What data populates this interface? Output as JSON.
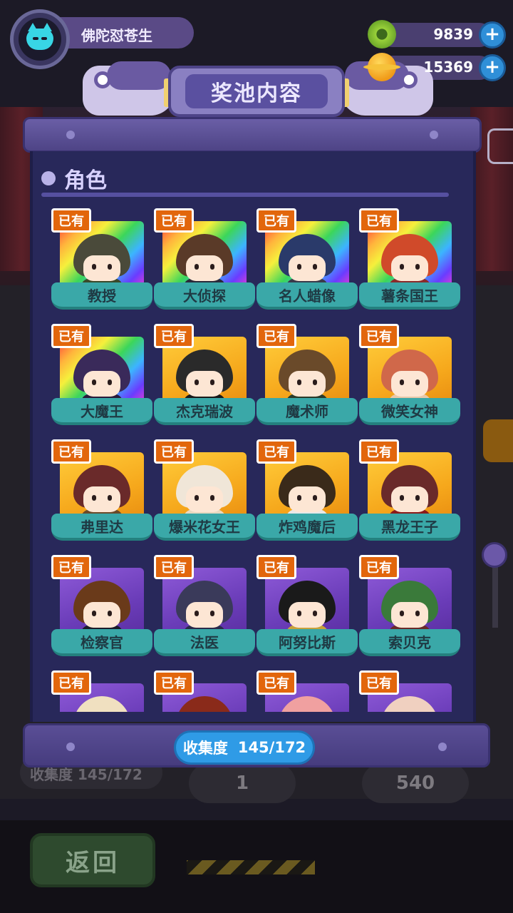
{
  "player": {
    "name": "佛陀怼苍生",
    "avatar_icon": "cat-avatar-icon"
  },
  "currencies": [
    {
      "icon": "donut-coin-icon",
      "value": "9839",
      "plus": "+"
    },
    {
      "icon": "planet-gem-icon",
      "value": "15369",
      "plus": "+"
    }
  ],
  "panel": {
    "title": "奖池内容",
    "category": "角色",
    "owned_label": "已有",
    "progress": {
      "label": "收集度",
      "value": "145/172"
    }
  },
  "characters": [
    {
      "name": "教授",
      "rarity": "rainbow",
      "hair": "#4a4a3a",
      "body": "#3a4a2a"
    },
    {
      "name": "大侦探",
      "rarity": "rainbow",
      "hair": "#5a3a28",
      "body": "#2a2a3a"
    },
    {
      "name": "名人蜡像",
      "rarity": "rainbow",
      "hair": "#2a3a6a",
      "body": "#3a3a4a"
    },
    {
      "name": "薯条国王",
      "rarity": "rainbow",
      "hair": "#d04a2a",
      "body": "#8a2a2a"
    },
    {
      "name": "大魔王",
      "rarity": "rainbow",
      "hair": "#3a2a5a",
      "body": "#2a1a3a"
    },
    {
      "name": "杰克瑞波",
      "rarity": "gold",
      "hair": "#2a2a2a",
      "body": "#1a1a1a"
    },
    {
      "name": "魔术师",
      "rarity": "gold",
      "hair": "#6a4a2a",
      "body": "#2a3a2a"
    },
    {
      "name": "微笑女神",
      "rarity": "gold",
      "hair": "#d0684a",
      "body": "#e8c8a8"
    },
    {
      "name": "弗里达",
      "rarity": "gold",
      "hair": "#6a2a2a",
      "body": "#6a4a2a"
    },
    {
      "name": "爆米花女王",
      "rarity": "gold",
      "hair": "#f0e6d8",
      "body": "#e8d8c0"
    },
    {
      "name": "炸鸡魔后",
      "rarity": "gold",
      "hair": "#3a2a1a",
      "body": "#e8e8e8"
    },
    {
      "name": "黑龙王子",
      "rarity": "gold",
      "hair": "#6a2a2a",
      "body": "#8a1a1a"
    },
    {
      "name": "检察官",
      "rarity": "purple",
      "hair": "#6a3a1a",
      "body": "#1a1a2a"
    },
    {
      "name": "法医",
      "rarity": "purple",
      "hair": "#3a3a5a",
      "body": "#2a2a4a"
    },
    {
      "name": "阿努比斯",
      "rarity": "purple",
      "hair": "#1a1a1a",
      "body": "#c8a23a"
    },
    {
      "name": "索贝克",
      "rarity": "purple",
      "hair": "#3a7a3a",
      "body": "#6a2a2a"
    },
    {
      "name": "",
      "rarity": "purple",
      "hair": "#f0e0c0",
      "body": "#f0e0c0"
    },
    {
      "name": "",
      "rarity": "purple",
      "hair": "#8a2a1a",
      "body": "#5a2a1a"
    },
    {
      "name": "",
      "rarity": "purple",
      "hair": "#f0a0a0",
      "body": "#f0a0a0"
    },
    {
      "name": "",
      "rarity": "purple",
      "hair": "#f0d0c0",
      "body": "#f0d0c0"
    }
  ],
  "background": {
    "progress_ghost": "收集度  145/172",
    "counter_a": "1",
    "counter_b": "540",
    "back_button": "返回"
  }
}
